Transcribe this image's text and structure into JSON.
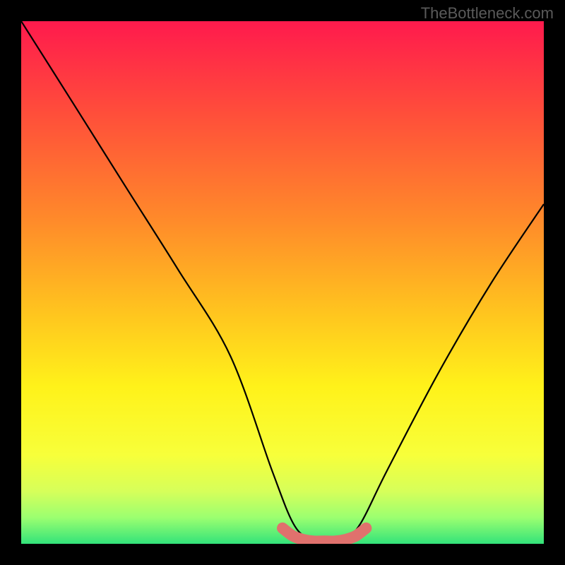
{
  "watermark": "TheBottleneck.com",
  "chart_data": {
    "type": "line",
    "title": "",
    "xlabel": "",
    "ylabel": "",
    "xlim": [
      0,
      100
    ],
    "ylim": [
      0,
      100
    ],
    "grid": false,
    "legend": false,
    "annotations": [],
    "series": [
      {
        "name": "curve",
        "color": "#000000",
        "x": [
          0,
          10,
          20,
          30,
          40,
          48,
          52,
          55,
          58,
          62,
          65,
          70,
          80,
          90,
          100
        ],
        "values": [
          100,
          84.2,
          68.3,
          52.5,
          36.0,
          14.0,
          4.0,
          1.0,
          0.5,
          1.0,
          4.0,
          14.0,
          33.0,
          50.0,
          65.0
        ]
      },
      {
        "name": "valley-highlight",
        "color": "#e0716d",
        "x": [
          50,
          52,
          54,
          56,
          58,
          60,
          62,
          64,
          66
        ],
        "values": [
          3.0,
          1.5,
          0.8,
          0.5,
          0.5,
          0.5,
          0.8,
          1.5,
          3.0
        ]
      }
    ],
    "background_gradient": {
      "type": "vertical",
      "stops": [
        {
          "offset": 0.0,
          "color": "#ff1a4d"
        },
        {
          "offset": 0.18,
          "color": "#ff4f3a"
        },
        {
          "offset": 0.38,
          "color": "#ff8a2a"
        },
        {
          "offset": 0.55,
          "color": "#ffc21f"
        },
        {
          "offset": 0.7,
          "color": "#fff21a"
        },
        {
          "offset": 0.83,
          "color": "#f7ff3a"
        },
        {
          "offset": 0.9,
          "color": "#d6ff5a"
        },
        {
          "offset": 0.95,
          "color": "#9bff70"
        },
        {
          "offset": 1.0,
          "color": "#33e37a"
        }
      ]
    }
  }
}
